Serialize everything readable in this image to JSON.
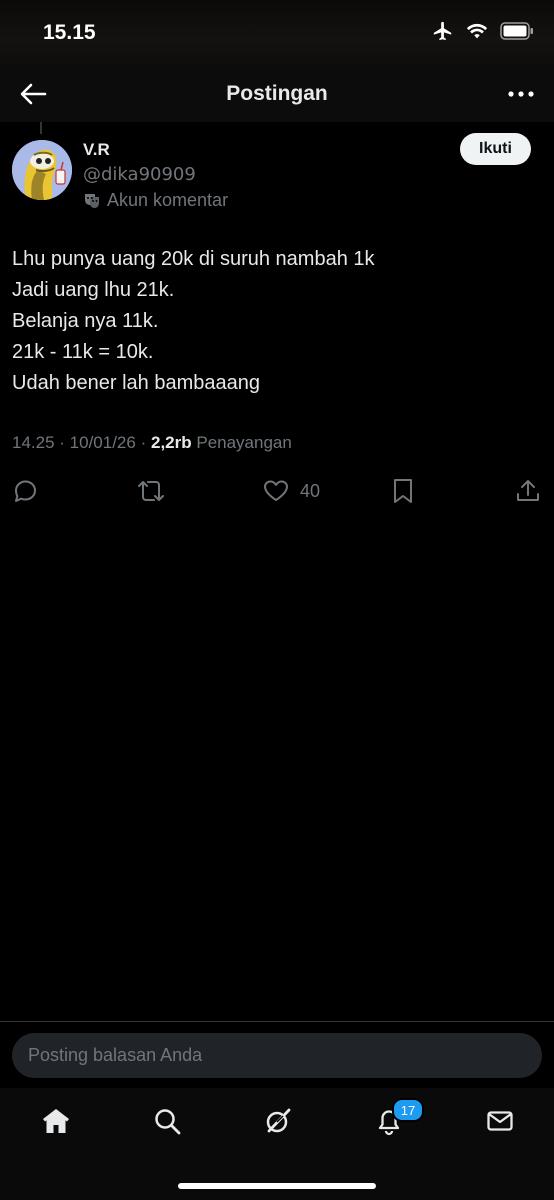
{
  "status": {
    "time": "15.15"
  },
  "header": {
    "title": "Postingan"
  },
  "post": {
    "display_name": "V.R",
    "handle": "@dika90909",
    "account_label": "Akun komentar",
    "follow_label": "Ikuti",
    "lines": [
      "Lhu punya uang 20k di suruh nambah 1k",
      "Jadi uang lhu 21k.",
      "Belanja nya 11k.",
      "21k - 11k = 10k.",
      "Udah bener lah bambaaang"
    ],
    "time": "14.25",
    "date": "10/01/26",
    "views_count": "2,2rb",
    "views_label": "Penayangan",
    "likes": "40"
  },
  "reply": {
    "placeholder": "Posting balasan Anda"
  },
  "tabs": {
    "notifications_badge": "17"
  },
  "colors": {
    "accent": "#1d9bf0",
    "muted": "#71767b",
    "text": "#e7e9ea"
  }
}
